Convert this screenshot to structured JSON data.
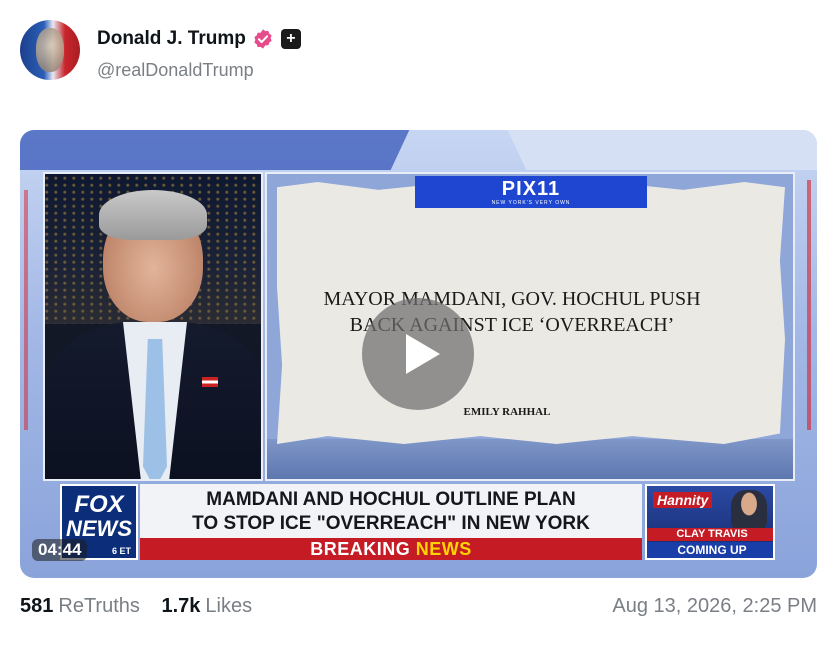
{
  "post": {
    "display_name": "Donald J. Trump",
    "handle": "@realDonaldTrump",
    "verified_icon": "verified-badge-icon",
    "extra_icon": "plus-icon",
    "colors": {
      "verified": "#e64c8c",
      "muted_text": "#7a7f85"
    }
  },
  "video": {
    "duration": "04:44",
    "news_banner": "PIX11",
    "news_banner_tag": "NEW YORK'S VERY OWN",
    "article_headline_line1": "MAYOR MAMDANI, GOV. HOCHUL PUSH",
    "article_headline_line2": "BACK AGAINST ICE ‘OVERREACH’",
    "article_byline": "EMILY RAHHAL",
    "network_logo_line1": "FOX",
    "network_logo_line2": "NEWS",
    "clock_suffix": "6 ET",
    "chyron_line1": "MAMDANI AND HOCHUL OUTLINE PLAN",
    "chyron_line2": "TO STOP ICE \"OVERREACH\" IN NEW YORK",
    "breaking_word1": "BREAKING",
    "breaking_word2": "NEWS",
    "promo_show": "Hannity",
    "promo_guest": "CLAY TRAVIS",
    "promo_status": "COMING UP"
  },
  "stats": {
    "retruths_count": "581",
    "retruths_label": "ReTruths",
    "likes_count": "1.7k",
    "likes_label": "Likes",
    "timestamp": "Aug 13, 2026, 2:25 PM"
  }
}
